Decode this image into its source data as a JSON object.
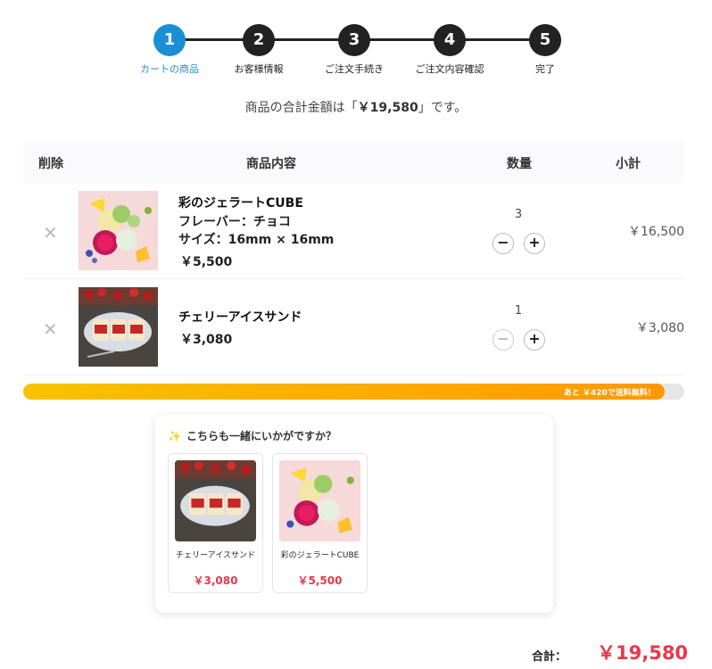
{
  "stepper": {
    "steps": [
      {
        "num": "1",
        "label": "カートの商品"
      },
      {
        "num": "2",
        "label": "お客様情報"
      },
      {
        "num": "3",
        "label": "ご注文手続き"
      },
      {
        "num": "4",
        "label": "ご注文内容確認"
      },
      {
        "num": "5",
        "label": "完了"
      }
    ],
    "active_step": 1,
    "active_color": "#1a8fd6"
  },
  "summary": {
    "prefix": "商品の合計金額は「",
    "amount": "￥19,580",
    "suffix": "」です。"
  },
  "table": {
    "headers": {
      "delete": "削除",
      "content": "商品内容",
      "qty": "数量",
      "subtotal": "小計"
    },
    "rows": [
      {
        "name": "彩のジェラートCUBE",
        "flavor": "フレーバー：チョコ",
        "size": "サイズ：16mm × 16mm",
        "price": "￥5,500",
        "qty": "3",
        "subtotal": "￥16,500",
        "image": "gelato-cube-image"
      },
      {
        "name": "チェリーアイスサンド",
        "price": "￥3,080",
        "qty": "1",
        "subtotal": "￥3,080",
        "image": "cherry-ice-sandwich-image"
      }
    ],
    "remove_icon": "close-icon",
    "minus_icon": "minus-icon",
    "plus_icon": "plus-icon"
  },
  "shipping_progress": {
    "text": "あと ￥420で送料無料！",
    "fraction": 0.97
  },
  "recommend": {
    "title": "こちらも一緒にいかがですか？",
    "title_icon": "sparkle-icon",
    "items": [
      {
        "name": "チェリーアイスサンド",
        "price": "￥3,080",
        "image": "cherry-ice-sandwich-image"
      },
      {
        "name": "彩のジェラートCUBE",
        "price": "￥5,500",
        "image": "gelato-cube-image"
      }
    ]
  },
  "total": {
    "label": "合計：",
    "value": "￥19,580",
    "color": "#e8374a"
  }
}
